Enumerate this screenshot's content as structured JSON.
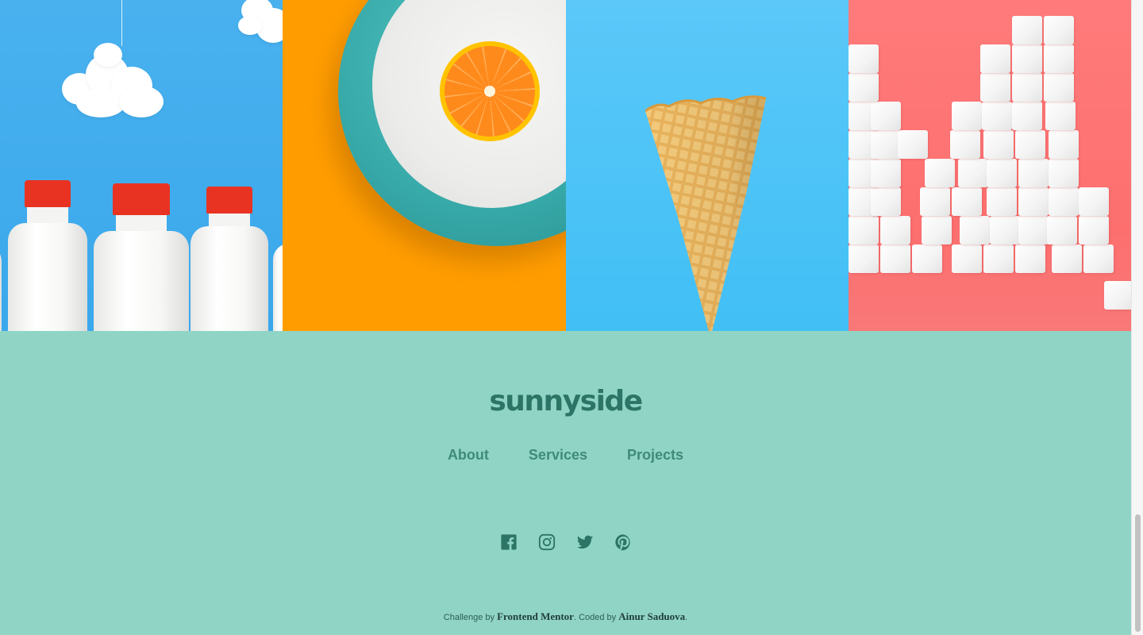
{
  "gallery": {
    "images": [
      {
        "name": "milk-bottles-image",
        "subject": "milk bottles under clouds"
      },
      {
        "name": "orange-plate-image",
        "subject": "orange slice on a plate"
      },
      {
        "name": "ice-cream-cone-image",
        "subject": "waffle cone"
      },
      {
        "name": "sugar-cubes-image",
        "subject": "sugar cubes"
      }
    ],
    "colors": {
      "milk_bg": "#49b1ee",
      "orange_bg": "#ff9d00",
      "cone_bg": "#5bc8f9",
      "sugar_bg": "#ff7b7b"
    }
  },
  "footer": {
    "logo": "sunnyside",
    "nav": [
      "About",
      "Services",
      "Projects"
    ],
    "socials": [
      "facebook-icon",
      "instagram-icon",
      "twitter-icon",
      "pinterest-icon"
    ],
    "credit": {
      "prefix": "Challenge by ",
      "challenge_link": "Frontend Mentor",
      "middle": ". Coded by ",
      "author_link": "Ainur Saduova",
      "suffix": "."
    },
    "colors": {
      "background": "#90d4c5",
      "logo": "#2c7566",
      "nav": "#3f8a7a"
    }
  }
}
